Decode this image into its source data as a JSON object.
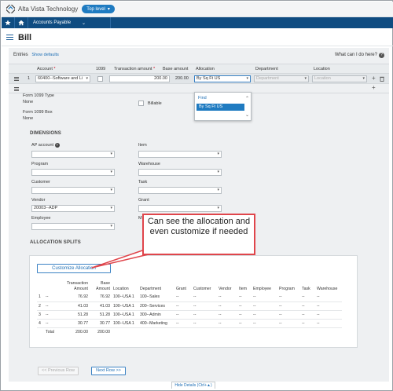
{
  "app": {
    "company": "Alta Vista Technology",
    "level": "Top level",
    "module": "Accounts Payable"
  },
  "page": {
    "title": "Bill"
  },
  "entries": {
    "label": "Entries",
    "show_defaults": "Show defaults",
    "help": "What can I do here?"
  },
  "grid": {
    "headers": {
      "account": "Account",
      "col1099": "1099",
      "transaction_amount": "Transaction amount",
      "base_amount": "Base amount",
      "allocation": "Allocation",
      "department": "Department",
      "location": "Location"
    },
    "row1": {
      "num": "1",
      "account": "60400--Software and Li",
      "transaction_amount": "200.00",
      "base_amount": "200.00",
      "allocation": "By Sq Ft US",
      "department": "Department",
      "location": "Location"
    }
  },
  "allocation_dropdown": {
    "find": "Find",
    "option": "By Sq Ft US"
  },
  "detail": {
    "form1099_type_label": "Form 1099 Type",
    "form1099_type_value": "None",
    "form1099_box_label": "Form 1099 Box",
    "form1099_box_value": "None",
    "billable_label": "Billable",
    "dimensions_title": "DIMENSIONS",
    "ap_account": "AP account",
    "item": "Item",
    "program": "Program",
    "warehouse": "Warehouse",
    "customer": "Customer",
    "task": "Task",
    "vendor": "Vendor",
    "vendor_value": "20003--ADP",
    "grant": "Grant",
    "employee": "Employee",
    "allocation_splits_title": "ALLOCATION SPLITS"
  },
  "callout": {
    "text": "Can see the allocation and even customize if needed"
  },
  "splits": {
    "customize_button": "Customize Allocation",
    "headers": [
      "",
      "",
      "Transaction Amount",
      "Base Amount",
      "Location",
      "Department",
      "Grant",
      "Customer",
      "Vendor",
      "Item",
      "Employee",
      "Program",
      "Task",
      "Warehouse"
    ],
    "rows": [
      [
        "1",
        "--",
        "76.92",
        "76.92",
        "100--USA 1",
        "100--Sales",
        "--",
        "--",
        "--",
        "--",
        "--",
        "--",
        "--",
        "--"
      ],
      [
        "2",
        "--",
        "41.03",
        "41.03",
        "100--USA 1",
        "200--Services",
        "--",
        "--",
        "--",
        "--",
        "--",
        "--",
        "--",
        "--"
      ],
      [
        "3",
        "--",
        "51.28",
        "51.28",
        "100--USA 1",
        "300--Admin",
        "--",
        "--",
        "--",
        "--",
        "--",
        "--",
        "--",
        "--"
      ],
      [
        "4",
        "--",
        "30.77",
        "30.77",
        "100--USA 1",
        "400--Marketing",
        "--",
        "--",
        "--",
        "--",
        "--",
        "--",
        "--",
        "--"
      ]
    ],
    "total_label": "Total",
    "total_transaction": "200.00",
    "total_base": "200.00"
  },
  "footer": {
    "prev": "<< Previous Row",
    "next": "Next Row >>",
    "hide_details": "Hide Details (Ctrl+▲)"
  }
}
